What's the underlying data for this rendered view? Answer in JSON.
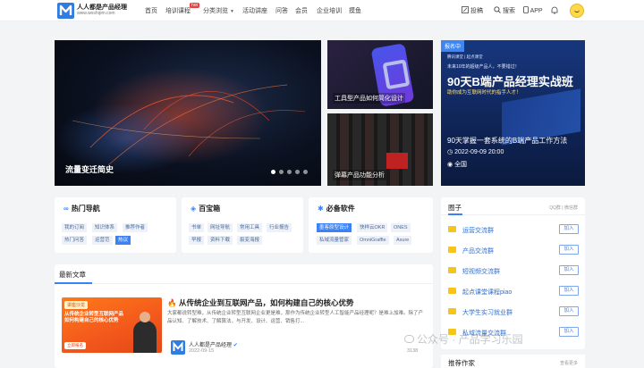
{
  "header": {
    "logo_name": "人人都是产品经理",
    "logo_url": "www.woshipm.com",
    "nav": [
      "首页",
      "培训课程",
      "分类浏览",
      "活动讲座",
      "问答",
      "会员",
      "企业培训",
      "摸鱼"
    ],
    "hot_badge": "hot",
    "right": {
      "post": "投稿",
      "search": "搜索",
      "app": "APP"
    }
  },
  "hero": {
    "main_caption": "流量变迁简史",
    "tile1_caption": "工具型产品如何简化设计",
    "tile2_caption": "弹幕产品功能分析",
    "promo": {
      "badge": "报名中",
      "logos": "腾讯课堂 | 起点课堂",
      "sub": "未来10年的超级产品人，不要错过！",
      "big": "90天B端产品经理实战班",
      "ribbon": "助你成为互联网时代的指手人才！",
      "title": "90天掌握一套系统的B端产品工作方法",
      "date": "2022-09-09 20:00",
      "location": "全国"
    }
  },
  "hot_nav": {
    "title": "热门导航",
    "chips": [
      "我的订阅",
      "知识体系",
      "推荐作者",
      "热门问答",
      "运营范",
      "热议"
    ]
  },
  "toolbox": {
    "title": "百宝箱",
    "chips": [
      "书单",
      "网址导航",
      "常用工具",
      "行业报告",
      "早报",
      "资料下载",
      "裂变海报"
    ]
  },
  "software": {
    "title": "必备软件",
    "chips": [
      "墨客原型设计",
      "快样云OKR",
      "ONES",
      "私域流量管家",
      "OmniGraffle",
      "Axure"
    ]
  },
  "articles": {
    "tab": "最新文章",
    "item": {
      "thumb_tag": "讲座沙龙",
      "thumb_text": "从传统企业转型互联网产品 如何构建自己的核心优势",
      "thumb_btn": "立即报名",
      "title": "从传统企业到互联网产品，如何构建自己的核心优势",
      "excerpt": "大家都说转型难，从传统企业转型互联网企业更是难，那作为传统企业转型人工智能产品经理呢？是难上加难。除了产品认知、了解技术、了解算法，与开发、设计、运营、销售打...",
      "author": "人人都是产品经理",
      "date": "2022-09-15",
      "views": "3138"
    }
  },
  "groups": {
    "title": "圈子",
    "tabs": "QQ群 | 微信群",
    "join_label": "加入",
    "items": [
      "运营交流群",
      "产品交流群",
      "短视频交流群",
      "起点课堂课程piao",
      "大学生实习就业群",
      "私域流量交流群"
    ]
  },
  "recommend": {
    "title": "推荐作家",
    "more": "查看更多"
  },
  "watermark": "公众号 · 产品学习乐园"
}
